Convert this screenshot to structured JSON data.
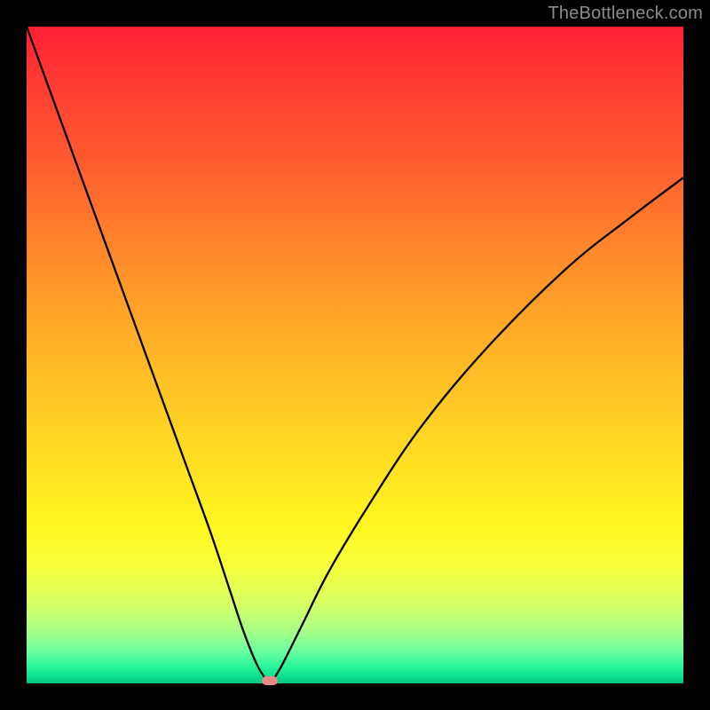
{
  "watermark": "TheBottleneck.com",
  "chart_data": {
    "type": "line",
    "title": "",
    "xlabel": "",
    "ylabel": "",
    "xlim": [
      0,
      100
    ],
    "ylim": [
      0,
      100
    ],
    "grid": false,
    "legend": false,
    "gradient": {
      "direction": "top-to-bottom",
      "stops": [
        {
          "pos": 0,
          "color": "#ff1f33"
        },
        {
          "pos": 50,
          "color": "#ffb827"
        },
        {
          "pos": 80,
          "color": "#fff71f"
        },
        {
          "pos": 100,
          "color": "#06c57e"
        }
      ]
    },
    "series": [
      {
        "name": "bottleneck-curve",
        "x": [
          0,
          4,
          8,
          12,
          16,
          20,
          24,
          28,
          31,
          33,
          35,
          36.5,
          37,
          37.5,
          39,
          42,
          46,
          52,
          60,
          70,
          82,
          92,
          100
        ],
        "values": [
          100,
          89,
          78,
          67,
          56,
          45,
          34,
          23,
          14,
          8,
          3,
          0.5,
          0,
          0.5,
          3,
          9,
          17,
          27,
          39,
          51,
          63,
          71,
          77
        ]
      }
    ],
    "marker": {
      "x": 37,
      "y": 0,
      "color": "#e98a86",
      "shape": "pill"
    }
  }
}
